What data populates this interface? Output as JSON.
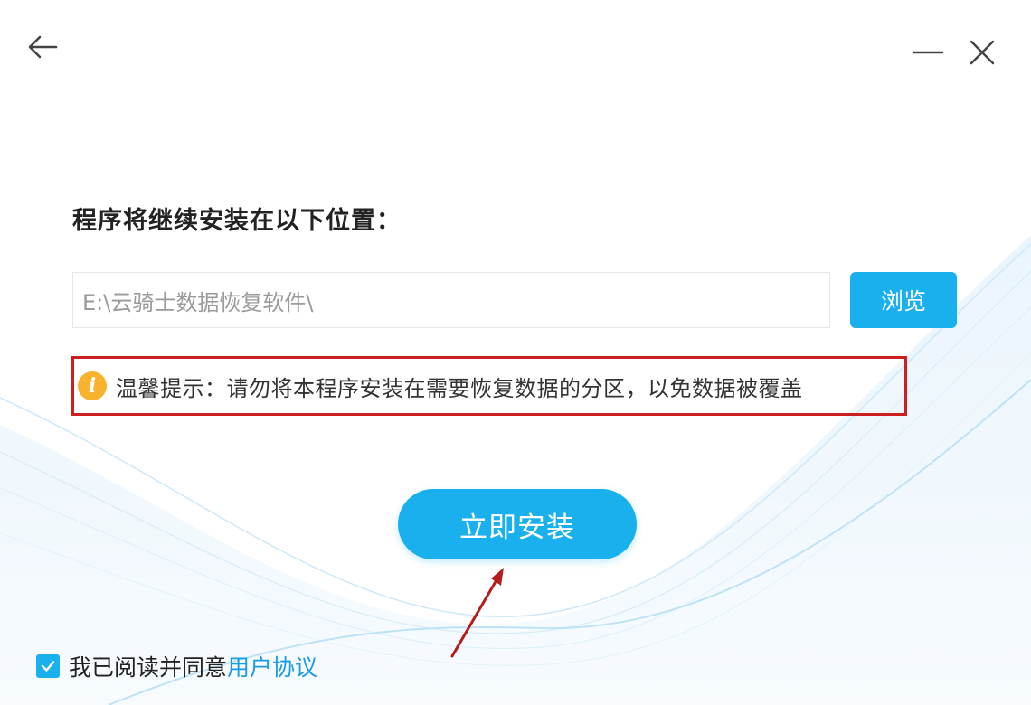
{
  "window": {
    "back_icon": "arrow-left-icon",
    "minimize_icon": "minimize-icon",
    "close_icon": "close-icon"
  },
  "main": {
    "location_label": "程序将继续安装在以下位置：",
    "install_path": "E:\\云骑士数据恢复软件\\",
    "browse_label": "浏览",
    "tip": {
      "icon": "info-icon",
      "text": "温馨提示：请勿将本程序安装在需要恢复数据的分区，以免数据被覆盖"
    },
    "install_label": "立即安装"
  },
  "footer": {
    "agreement_checked": true,
    "agreement_prefix": "我已阅读并同意",
    "agreement_link": "用户协议"
  },
  "colors": {
    "accent": "#1ab0ee",
    "tip_border": "#cc1f1f",
    "info_icon": "#f7b32b",
    "link": "#1a9be6"
  }
}
